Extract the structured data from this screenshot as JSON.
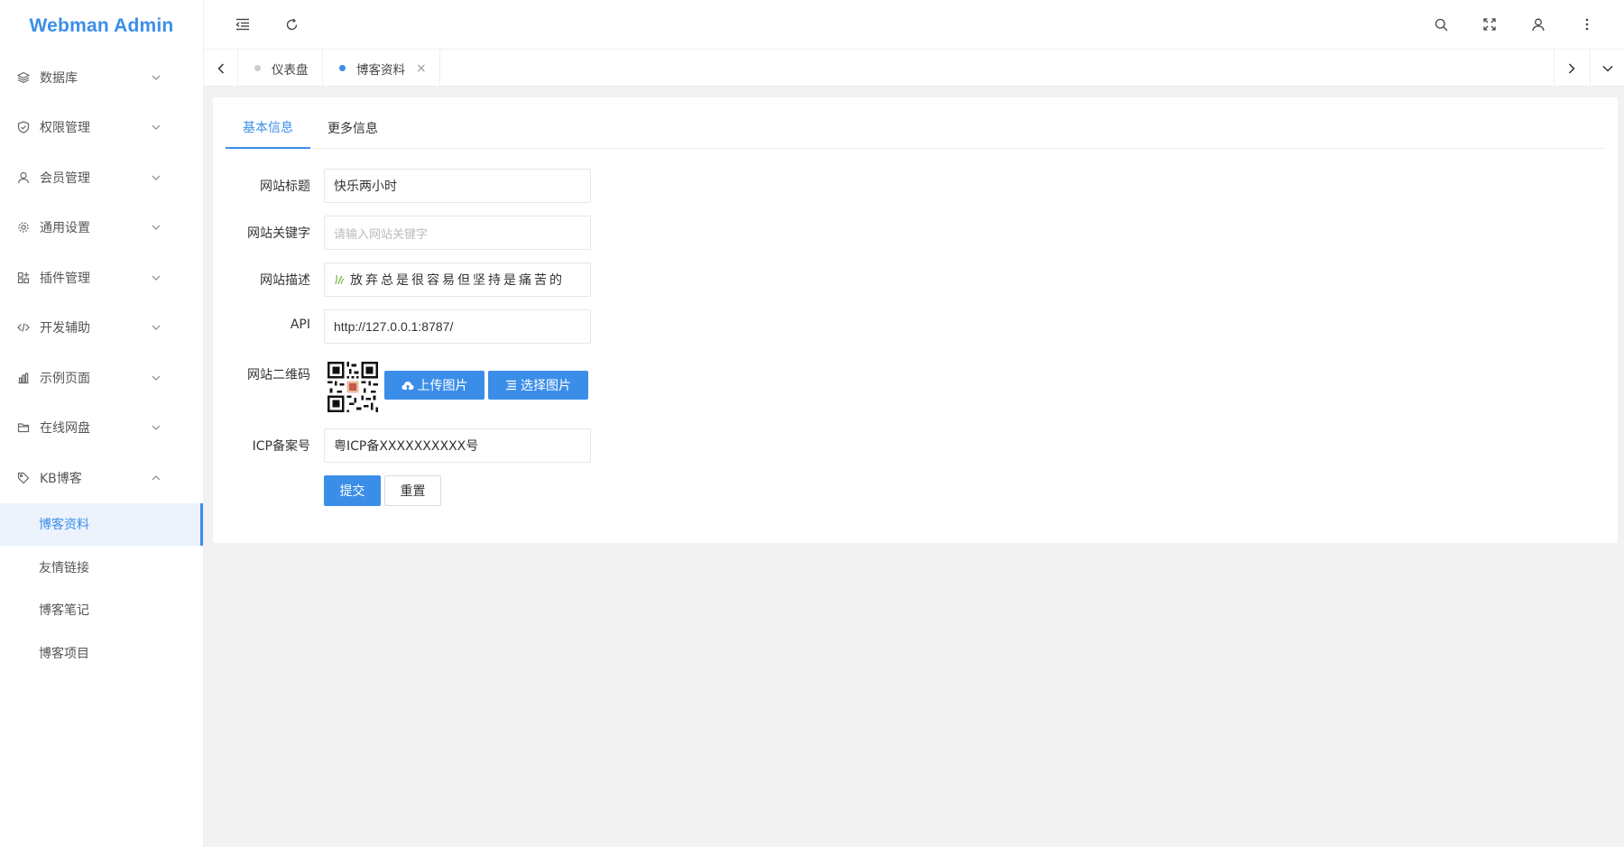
{
  "app": {
    "title": "Webman Admin"
  },
  "sidebar": {
    "items": [
      {
        "label": "数据库",
        "icon": "layers-icon"
      },
      {
        "label": "权限管理",
        "icon": "shield-check-icon"
      },
      {
        "label": "会员管理",
        "icon": "user-icon"
      },
      {
        "label": "通用设置",
        "icon": "gear-icon"
      },
      {
        "label": "插件管理",
        "icon": "apps-icon"
      },
      {
        "label": "开发辅助",
        "icon": "code-icon"
      },
      {
        "label": "示例页面",
        "icon": "chart-icon"
      },
      {
        "label": "在线网盘",
        "icon": "folder-icon"
      },
      {
        "label": "KB博客",
        "icon": "tag-icon"
      }
    ],
    "sub_items": [
      {
        "label": "博客资料",
        "active": true
      },
      {
        "label": "友情链接"
      },
      {
        "label": "博客笔记"
      },
      {
        "label": "博客项目"
      }
    ]
  },
  "tabs": [
    {
      "label": "仪表盘",
      "dot_color": "#cccccc"
    },
    {
      "label": "博客资料",
      "dot_color": "#3b8ee8",
      "closable": true,
      "close": "×"
    }
  ],
  "form": {
    "tabs": [
      "基本信息",
      "更多信息"
    ],
    "fields": {
      "title": {
        "label": "网站标题",
        "value": "快乐两小时"
      },
      "keywords": {
        "label": "网站关键字",
        "placeholder": "请输入网站关键字"
      },
      "description": {
        "label": "网站描述",
        "value": "放弃总是很容易但坚持是痛苦的"
      },
      "api": {
        "label": "API",
        "value": "http://127.0.0.1:8787/"
      },
      "qrcode": {
        "label": "网站二维码",
        "upload": "上传图片",
        "select": "选择图片"
      },
      "icp": {
        "label": "ICP备案号",
        "value": "粤ICP备XXXXXXXXXX号"
      }
    },
    "submit": "提交",
    "reset": "重置"
  },
  "colors": {
    "accent": "#3b8ee8"
  }
}
